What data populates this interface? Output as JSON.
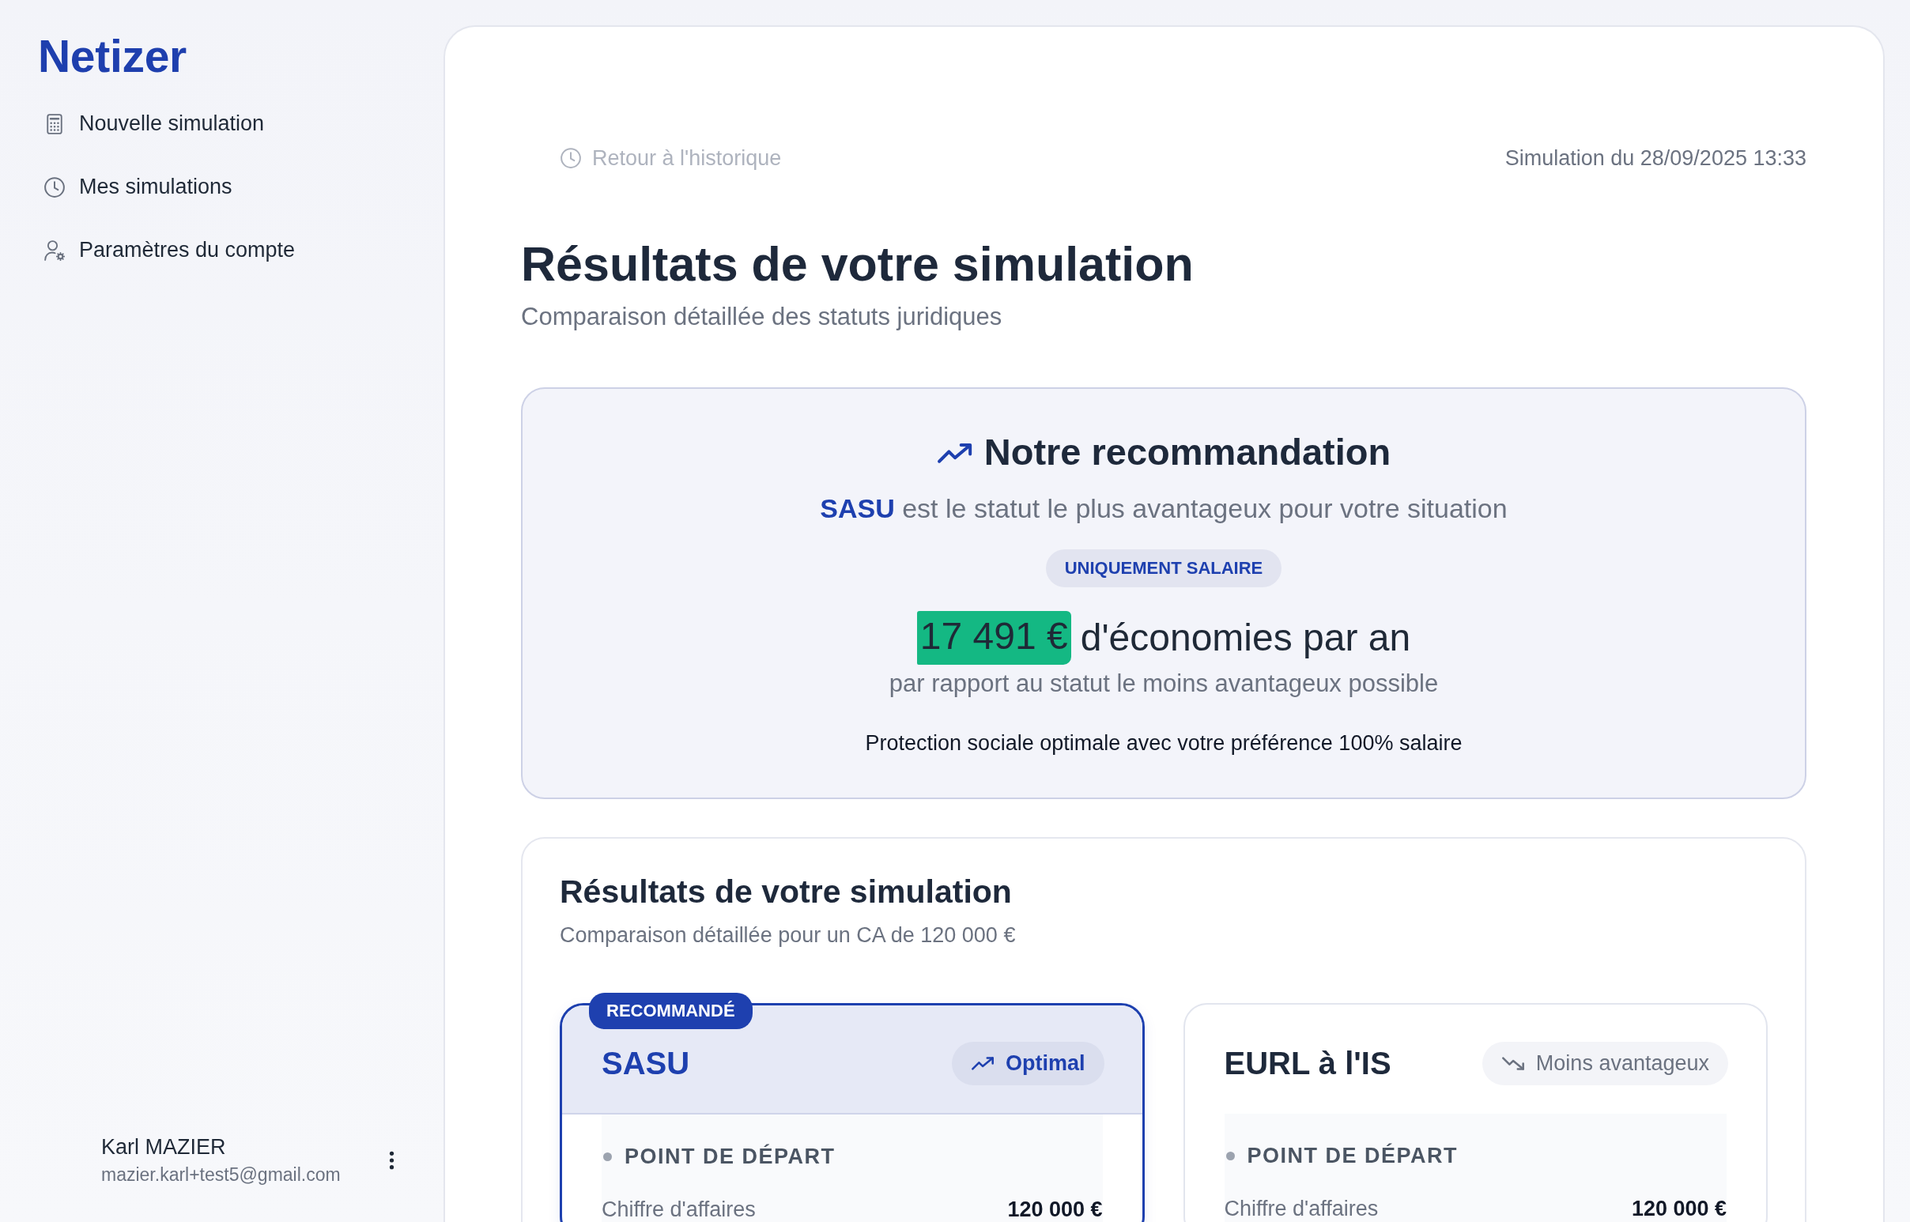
{
  "sidebar": {
    "logo": "Netizer",
    "nav_items": [
      {
        "label": "Nouvelle simulation"
      },
      {
        "label": "Mes simulations"
      },
      {
        "label": "Paramètres du compte"
      }
    ],
    "user": {
      "name": "Karl MAZIER",
      "email": "mazier.karl+test5@gmail.com"
    }
  },
  "header": {
    "back_link": "Retour à l'historique",
    "simulation_date": "Simulation du 28/09/2025 13:33"
  },
  "title": "Résultats de votre simulation",
  "subtitle": "Comparaison détaillée des statuts juridiques",
  "recommendation": {
    "title": "Notre recommandation",
    "statement": "**SASU** est le statut le plus avantageux pour votre situation",
    "badge": "UNIQUEMENT SALAIRE",
    "savings_amount": "17 491 €",
    "savings_label": "d'économies par an",
    "comparison_note": "par rapport au statut le moins avantageux possible",
    "note": "Protection sociale optimale avec votre préférence 100% salaire"
  },
  "results": {
    "title": "Résultats de votre simulation",
    "subtitle": "Comparaison détaillée pour un CA de 120 000 €",
    "statuses": [
      {
        "name": "SASU",
        "recommended": true,
        "badge": "RECOMMANDÉ",
        "rating": "Optimal",
        "sections": [
          {
            "title": "POINT DE DÉPART",
            "rows": [
              {
                "label": "Chiffre d'affaires",
                "value": "120 000 €"
              }
            ]
          }
        ]
      },
      {
        "name": "EURL à l'IS",
        "recommended": false,
        "rating": "Moins avantageux",
        "sections": [
          {
            "title": "POINT DE DÉPART",
            "rows": [
              {
                "label": "Chiffre d'affaires",
                "value": "120 000 €"
              }
            ]
          }
        ]
      }
    ]
  }
}
